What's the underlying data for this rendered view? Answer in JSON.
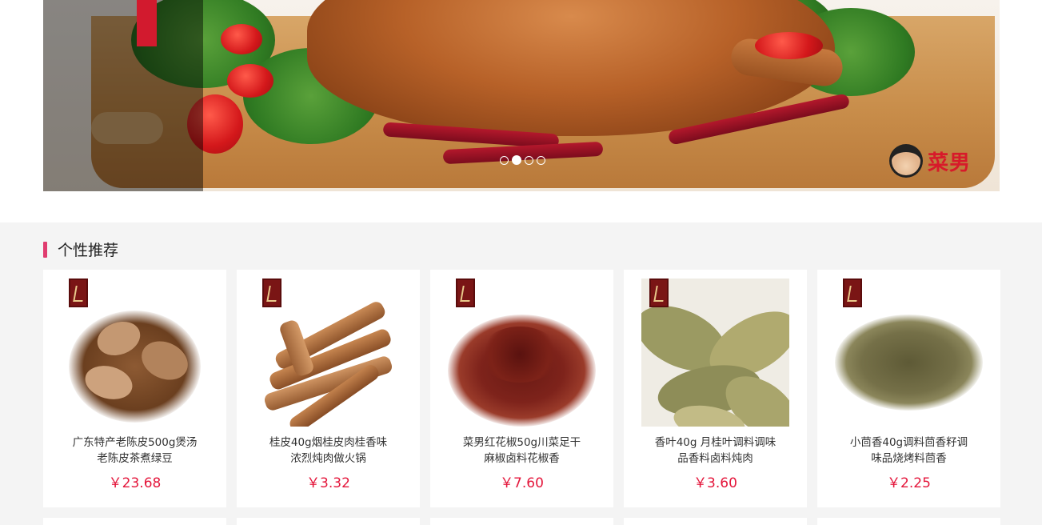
{
  "banner": {
    "logo_text": "菜男",
    "slides_total": 4,
    "active_slide": 2
  },
  "section": {
    "title": "个性推荐"
  },
  "products": [
    {
      "name": "广东特产老陈皮500g煲汤老陈皮茶煮绿豆",
      "price": "￥23.68",
      "image": "dried-tangerine-peel"
    },
    {
      "name": "桂皮40g烟桂皮肉桂香味浓烈炖肉做火锅",
      "price": "￥3.32",
      "image": "cinnamon-sticks"
    },
    {
      "name": "菜男红花椒50g川菜足干麻椒卤料花椒香",
      "price": "￥7.60",
      "image": "sichuan-peppercorn"
    },
    {
      "name": "香叶40g 月桂叶调料调味品香料卤料炖肉",
      "price": "￥3.60",
      "image": "bay-leaves"
    },
    {
      "name": "小茴香40g调料茴香籽调味品烧烤料茴香",
      "price": "￥2.25",
      "image": "fennel-seeds"
    }
  ],
  "colors": {
    "accent": "#e03c6f",
    "price": "#e4163b",
    "page_bg": "#f4f4f4"
  }
}
